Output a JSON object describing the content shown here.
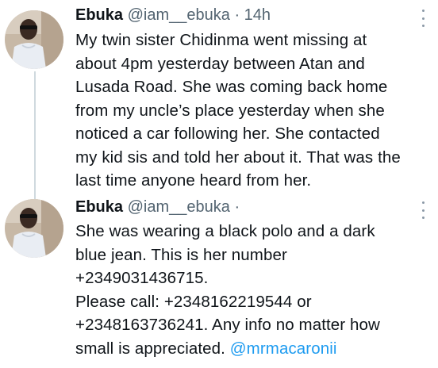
{
  "tweets": [
    {
      "author": "Ebuka",
      "handle": "@iam__ebuka",
      "separator": "·",
      "time": "14h",
      "lines": [
        "My twin sister Chidinma went missing at",
        "about 4pm yesterday between Atan and",
        "Lusada Road. She was coming back home",
        "from my uncle’s place yesterday when she",
        "noticed a car following her. She contacted",
        "my kid sis and told her about it. That was the",
        "last time anyone heard from her."
      ]
    },
    {
      "author": "Ebuka",
      "handle": "@iam__ebuka",
      "separator": "·",
      "time": "",
      "lines": [
        "She was wearing a black polo and a dark",
        "blue jean. This is her number",
        "+2349031436715.",
        "Please call: +2348162219544 or",
        "+2348163736241. Any info no matter how",
        "small is appreciated. "
      ],
      "mention": "@mrmacaronii"
    }
  ],
  "colors": {
    "text": "#0f1419",
    "secondary": "#536471",
    "link": "#1d9bf0",
    "thread_line": "#cfd9de"
  },
  "icons": {
    "more": "more-options-icon",
    "avatar": "profile-avatar"
  }
}
